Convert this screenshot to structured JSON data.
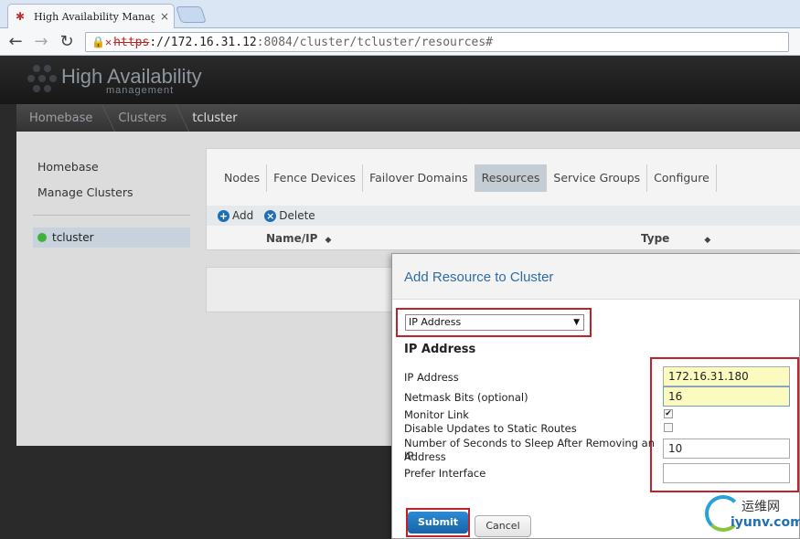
{
  "browser": {
    "tab_title": "High Availability Manag",
    "tab_close": "×",
    "url_protocol": "https",
    "url_sep": "://",
    "url_host": "172.16.31.12",
    "url_path": ":8084/cluster/tcluster/resources#"
  },
  "app": {
    "logo_title": "High Availability",
    "logo_subtitle": "management"
  },
  "breadcrumb": [
    "Homebase",
    "Clusters",
    "tcluster"
  ],
  "sidebar": {
    "homebase": "Homebase",
    "manage_clusters": "Manage Clusters",
    "cluster_name": "tcluster",
    "cluster_status_color": "#3fb23a"
  },
  "tabs": [
    "Nodes",
    "Fence Devices",
    "Failover Domains",
    "Resources",
    "Service Groups",
    "Configure"
  ],
  "active_tab": "Resources",
  "actions": {
    "add": "Add",
    "delete": "Delete"
  },
  "table": {
    "col_name": "Name/IP",
    "col_type": "Type"
  },
  "dialog": {
    "title": "Add Resource to Cluster",
    "resource_type": "IP Address",
    "section_title": "IP Address",
    "fields": {
      "ip_label": "IP Address",
      "ip_value": "172.16.31.180",
      "netmask_label": "Netmask Bits (optional)",
      "netmask_value": "16",
      "monitor_label": "Monitor Link",
      "monitor_checked": true,
      "disable_label": "Disable Updates to Static Routes",
      "disable_checked": false,
      "sleep_label_1": "Number of Seconds to Sleep After Removing an IP",
      "sleep_label_2": "Address",
      "sleep_value": "10",
      "prefer_label": "Prefer Interface",
      "prefer_value": ""
    },
    "submit": "Submit",
    "cancel": "Cancel"
  },
  "watermark": {
    "top": "运维网",
    "bottom": "iyunv.com"
  },
  "colors": {
    "highlight_red": "#c0222a",
    "accent_blue": "#2e6da4",
    "input_yellow": "#fbfbc0"
  }
}
